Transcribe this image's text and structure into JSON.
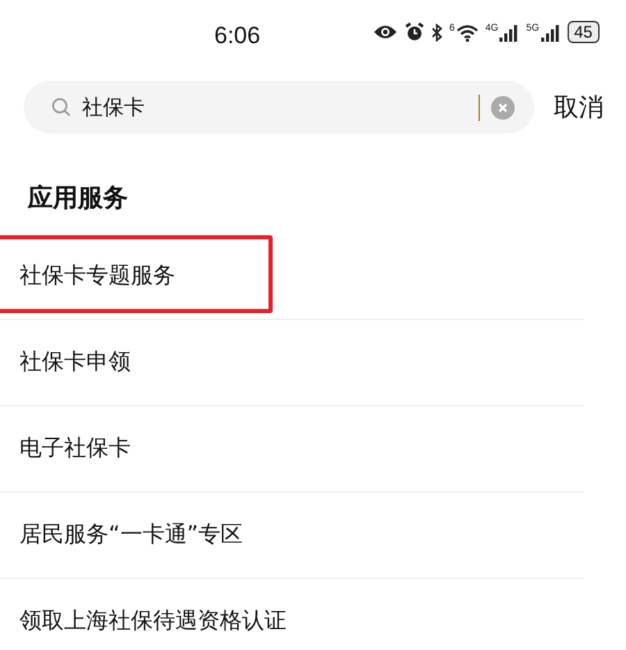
{
  "status_bar": {
    "time": "6:06",
    "wifi_label": "6",
    "network_labels": [
      "4G",
      "5G"
    ],
    "battery": "45"
  },
  "search": {
    "value": "社保卡",
    "cancel": "取消"
  },
  "section": {
    "title": "应用服务"
  },
  "results": [
    {
      "label": "社保卡专题服务",
      "highlighted": true
    },
    {
      "label": "社保卡申领",
      "highlighted": false
    },
    {
      "label": "电子社保卡",
      "highlighted": false
    },
    {
      "label": "居民服务“一卡通”专区",
      "highlighted": false
    },
    {
      "label": "领取上海社保待遇资格认证",
      "highlighted": false
    }
  ]
}
